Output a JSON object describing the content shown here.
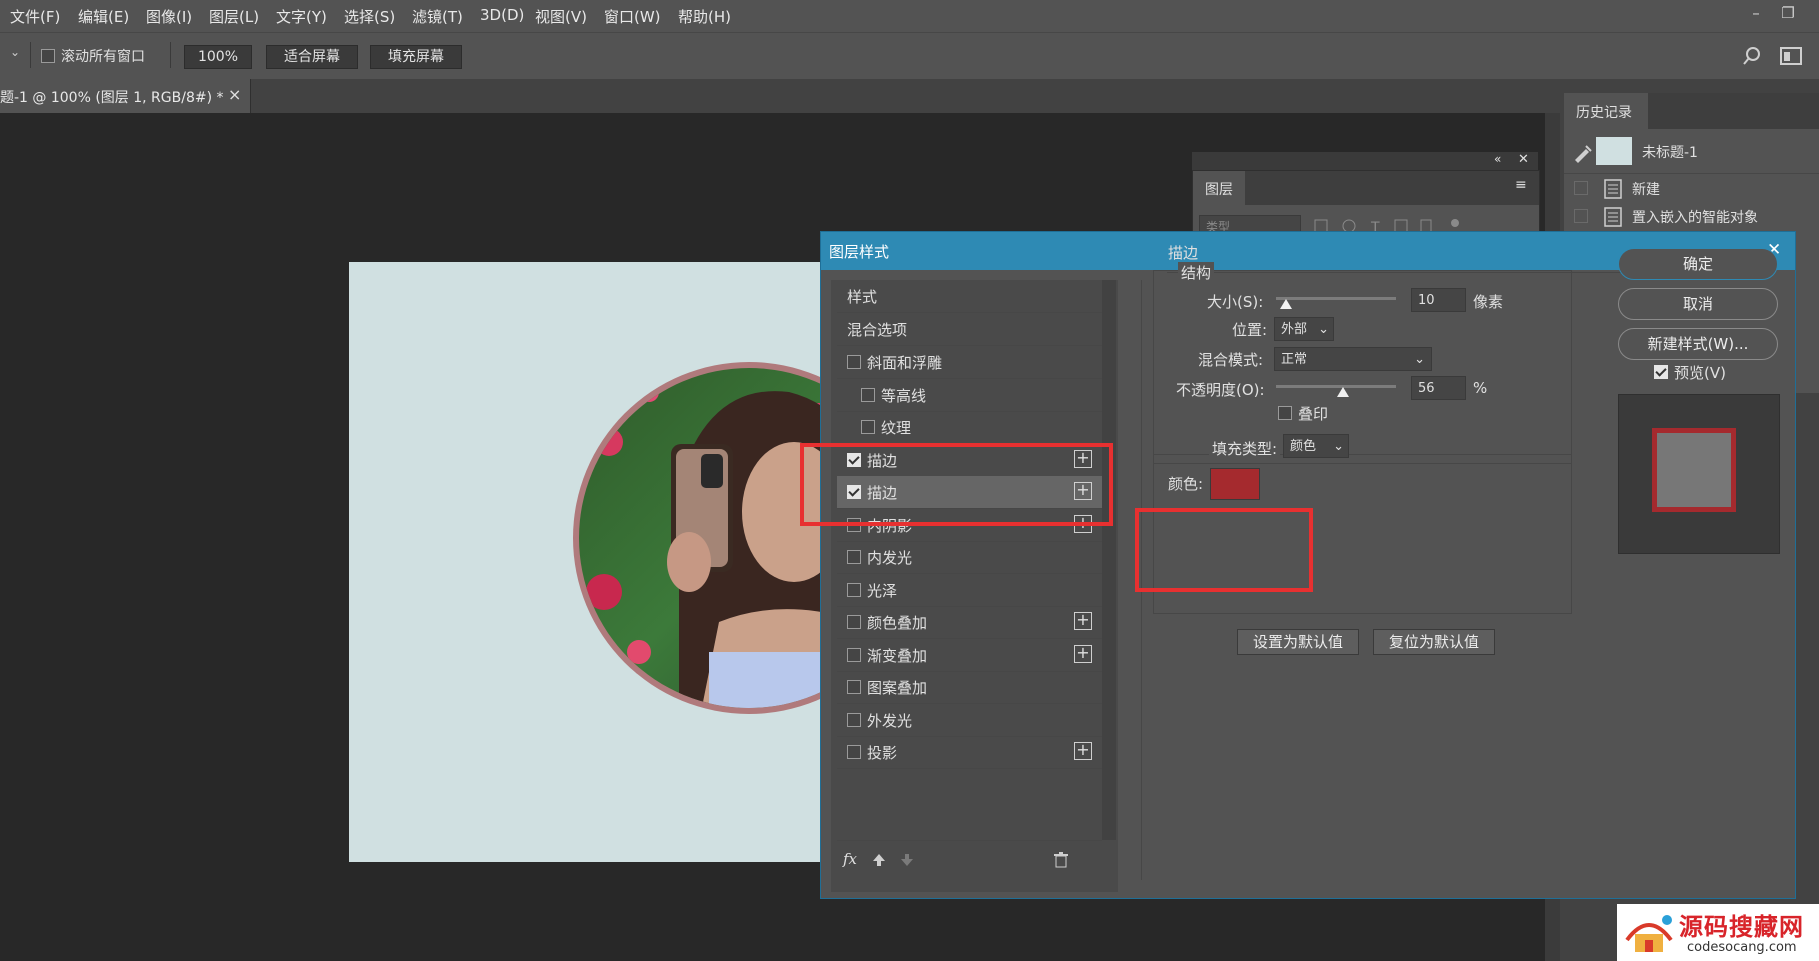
{
  "menu": [
    "文件(F)",
    "编辑(E)",
    "图像(I)",
    "图层(L)",
    "文字(Y)",
    "选择(S)",
    "滤镜(T)",
    "3D(D)",
    "视图(V)",
    "窗口(W)",
    "帮助(H)"
  ],
  "options_bar": {
    "scroll_all_label": "滚动所有窗口",
    "zoom": "100%",
    "fit_screen": "适合屏幕",
    "fill_screen": "填充屏幕"
  },
  "document_tab": {
    "title": "题-1 @ 100% (图层 1, RGB/8#) *",
    "close": "×"
  },
  "history_panel": {
    "tab": "历史记录",
    "snapshot": "未标题-1",
    "items": [
      "新建",
      "置入嵌入的智能对象"
    ]
  },
  "layers_panel": {
    "tab": "图层",
    "search_placeholder": "类型"
  },
  "dialog": {
    "title": "图层样式",
    "close": "✕",
    "styles_header": "样式",
    "blend_options": "混合选项",
    "effects": [
      {
        "label": "斜面和浮雕",
        "checked": false,
        "indent": false,
        "plus": false
      },
      {
        "label": "等高线",
        "checked": false,
        "indent": true,
        "plus": false
      },
      {
        "label": "纹理",
        "checked": false,
        "indent": true,
        "plus": false
      },
      {
        "label": "描边",
        "checked": true,
        "indent": false,
        "plus": true
      },
      {
        "label": "描边",
        "checked": true,
        "indent": false,
        "plus": true,
        "selected": true
      },
      {
        "label": "内阴影",
        "checked": false,
        "indent": false,
        "plus": true
      },
      {
        "label": "内发光",
        "checked": false,
        "indent": false,
        "plus": false
      },
      {
        "label": "光泽",
        "checked": false,
        "indent": false,
        "plus": false
      },
      {
        "label": "颜色叠加",
        "checked": false,
        "indent": false,
        "plus": true
      },
      {
        "label": "渐变叠加",
        "checked": false,
        "indent": false,
        "plus": true
      },
      {
        "label": "图案叠加",
        "checked": false,
        "indent": false,
        "plus": false
      },
      {
        "label": "外发光",
        "checked": false,
        "indent": false,
        "plus": false
      },
      {
        "label": "投影",
        "checked": false,
        "indent": false,
        "plus": true
      }
    ],
    "fx_label": "fx",
    "stroke": {
      "section": "描边",
      "structure": "结构",
      "size_label": "大小(S):",
      "size_value": "10",
      "size_unit": "像素",
      "size_slider": 0.08,
      "position_label": "位置:",
      "position_value": "外部",
      "blend_label": "混合模式:",
      "blend_value": "正常",
      "opacity_label": "不透明度(O):",
      "opacity_value": "56",
      "opacity_unit": "%",
      "opacity_slider": 0.56,
      "overprint_label": "叠印",
      "fill_type_label": "填充类型:",
      "fill_type_value": "颜色",
      "color_label": "颜色:",
      "color_value": "#a52a2e"
    },
    "set_default": "设置为默认值",
    "reset_default": "复位为默认值",
    "ok": "确定",
    "cancel": "取消",
    "new_style": "新建样式(W)...",
    "preview_label": "预览(V)"
  },
  "watermark": {
    "text": "源码搜藏网",
    "url": "codesocang.com"
  },
  "colors": {
    "canvas_bg": "#d0e0e1",
    "ring": "#b07a7c",
    "dialog_title": "#2e8ab4",
    "highlight": "#e83030"
  }
}
